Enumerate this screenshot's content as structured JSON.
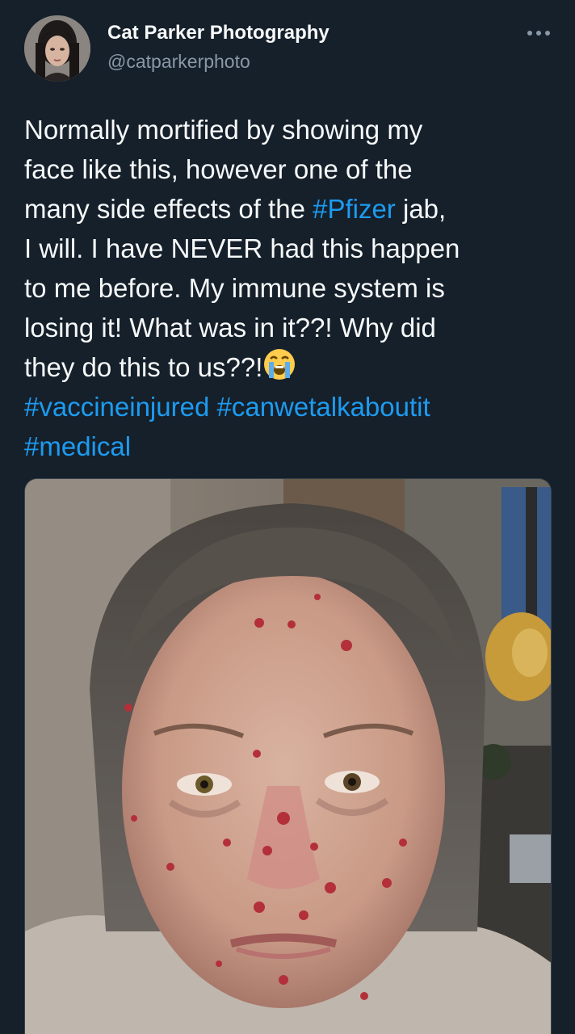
{
  "author": {
    "name": "Cat Parker Photography",
    "handle": "@catparkerphoto",
    "avatar_icon": "profile-photo"
  },
  "menu": {
    "icon": "more-horizontal-icon"
  },
  "tweet": {
    "lines": [
      {
        "parts": [
          {
            "text": "Normally mortified by showing my"
          }
        ]
      },
      {
        "parts": [
          {
            "text": "face like this, however one of the"
          }
        ]
      },
      {
        "parts": [
          {
            "text": "many side effects of the "
          },
          {
            "text": "#Pfizer",
            "hashtag": true
          },
          {
            "text": " jab,"
          }
        ]
      },
      {
        "parts": [
          {
            "text": "I will. I have NEVER had this happen"
          }
        ]
      },
      {
        "parts": [
          {
            "text": "to me before. My immune system is"
          }
        ]
      },
      {
        "parts": [
          {
            "text": "losing it! What was in it??! Why did"
          }
        ]
      },
      {
        "parts": [
          {
            "text": "they do this to us??!"
          },
          {
            "emoji": "loudly-crying-face"
          }
        ]
      },
      {
        "parts": [
          {
            "text": "#vaccineinjured",
            "hashtag": true
          },
          {
            "text": " "
          },
          {
            "text": "#canwetalkaboutit",
            "hashtag": true
          }
        ]
      },
      {
        "parts": [
          {
            "text": "#medical",
            "hashtag": true
          }
        ]
      }
    ]
  },
  "media": {
    "type": "photo",
    "subject": "selfie-photo"
  },
  "colors": {
    "background": "#15202b",
    "text": "#f7f9f9",
    "secondary_text": "#8b98a5",
    "link": "#1d9bf0"
  }
}
